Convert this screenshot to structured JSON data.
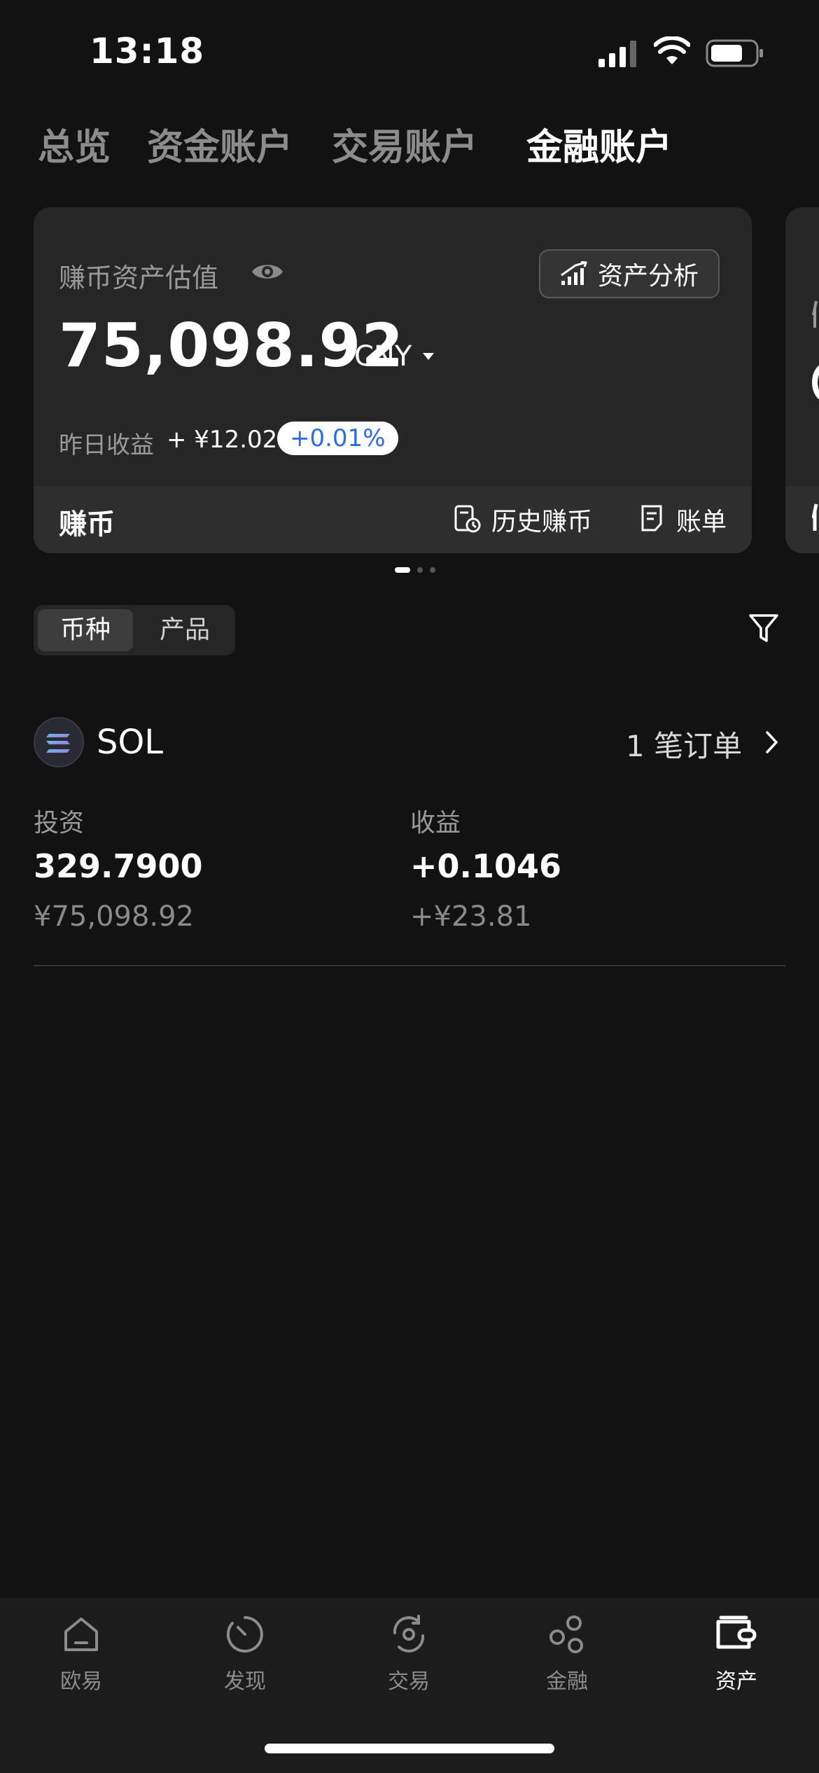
{
  "status_bar": {
    "time": "13:18"
  },
  "top_tabs": [
    {
      "label": "总览",
      "active": false
    },
    {
      "label": "资金账户",
      "active": false
    },
    {
      "label": "交易账户",
      "active": false
    },
    {
      "label": "金融账户",
      "active": true
    }
  ],
  "card": {
    "asset_label": "赚币资产估值",
    "analysis_button": "资产分析",
    "total_value": "75,098.92",
    "currency": "CNY",
    "yesterday_label": "昨日收益",
    "yesterday_value": "+ ¥12.02",
    "yesterday_pct": "+0.01%",
    "footer_title": "赚币",
    "history_label": "历史赚币",
    "bill_label": "账单"
  },
  "segmented": {
    "coin": "币种",
    "product": "产品",
    "active": "coin"
  },
  "holding": {
    "symbol": "SOL",
    "orders": "1 笔订单",
    "invest_label": "投资",
    "invest_amount": "329.7900",
    "invest_cny": "¥75,098.92",
    "profit_label": "收益",
    "profit_amount": "+0.1046",
    "profit_cny": "+¥23.81"
  },
  "bottom_nav": [
    {
      "label": "欧易",
      "icon": "home-icon",
      "active": false
    },
    {
      "label": "发现",
      "icon": "discover-icon",
      "active": false
    },
    {
      "label": "交易",
      "icon": "trade-icon",
      "active": false
    },
    {
      "label": "金融",
      "icon": "finance-icon",
      "active": false
    },
    {
      "label": "资产",
      "icon": "wallet-icon",
      "active": true
    }
  ],
  "colors": {
    "background": "#121212",
    "card": "#262626",
    "accent_blue": "#2f6be0"
  }
}
